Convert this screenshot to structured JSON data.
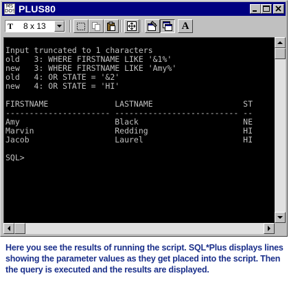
{
  "window": {
    "title": "PLUS80",
    "app_icon_text": [
      "MS",
      "DOS"
    ],
    "controls": [
      "minimize",
      "maximize",
      "close"
    ]
  },
  "toolbar": {
    "font_icon_label": "T",
    "font_size_value": "8 x 13",
    "tools": [
      {
        "name": "mark-icon"
      },
      {
        "name": "copy-icon"
      },
      {
        "name": "paste-icon"
      },
      {
        "name": "fullscreen-icon"
      },
      {
        "name": "properties-icon"
      },
      {
        "name": "background-icon"
      },
      {
        "name": "font-icon",
        "label": "A"
      }
    ]
  },
  "console": {
    "lines": [
      "Input truncated to 1 characters",
      "old   3: WHERE FIRSTNAME LIKE '&1%'",
      "new   3: WHERE FIRSTNAME LIKE 'Amy%'",
      "old   4: OR STATE = '&2'",
      "new   4: OR STATE = 'HI'",
      "",
      "FIRSTNAME              LASTNAME                   ST",
      "---------------------- -------------------------- --",
      "Amy                    Black                      NE",
      "Marvin                 Redding                    HI",
      "Jacob                  Laurel                     HI",
      "",
      "SQL>"
    ]
  },
  "caption": "Here you see the results of running the script. SQL*Plus displays lines showing the parameter values as they get placed into the script. Then the query is executed and the results are displayed.",
  "colors": {
    "titlebar": "#000080",
    "console_bg": "#000000",
    "console_text": "#c0c0c0",
    "caption_text": "#1a2f8a"
  }
}
